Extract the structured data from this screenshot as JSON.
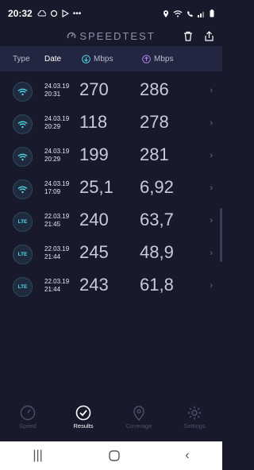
{
  "status": {
    "time": "20:32"
  },
  "app": {
    "brand": "SPEEDTEST"
  },
  "columns": {
    "type": "Type",
    "date": "Date",
    "download": "Mbps",
    "upload": "Mbps"
  },
  "rows": [
    {
      "type": "wifi",
      "date": "24.03.19",
      "time": "20:31",
      "download": "270",
      "upload": "286"
    },
    {
      "type": "wifi",
      "date": "24.03.19",
      "time": "20:29",
      "download": "118",
      "upload": "278"
    },
    {
      "type": "wifi",
      "date": "24.03.19",
      "time": "20:29",
      "download": "199",
      "upload": "281"
    },
    {
      "type": "wifi",
      "date": "24.03.19",
      "time": "17:09",
      "download": "25,1",
      "upload": "6,92"
    },
    {
      "type": "LTE",
      "date": "22.03.19",
      "time": "21:45",
      "download": "240",
      "upload": "63,7"
    },
    {
      "type": "LTE",
      "date": "22.03.19",
      "time": "21:44",
      "download": "245",
      "upload": "48,9"
    },
    {
      "type": "LTE",
      "date": "22.03.19",
      "time": "21:44",
      "download": "243",
      "upload": "61,8"
    }
  ],
  "nav": [
    {
      "label": "Speed",
      "icon": "speedometer-icon"
    },
    {
      "label": "Results",
      "icon": "check-circle-icon",
      "active": true
    },
    {
      "label": "Coverage",
      "icon": "map-pin-icon"
    },
    {
      "label": "Settings",
      "icon": "gear-icon"
    }
  ],
  "colors": {
    "background": "#181a2b",
    "header_band": "#232640",
    "download": "#4fd7e6",
    "upload": "#b07cf0"
  }
}
